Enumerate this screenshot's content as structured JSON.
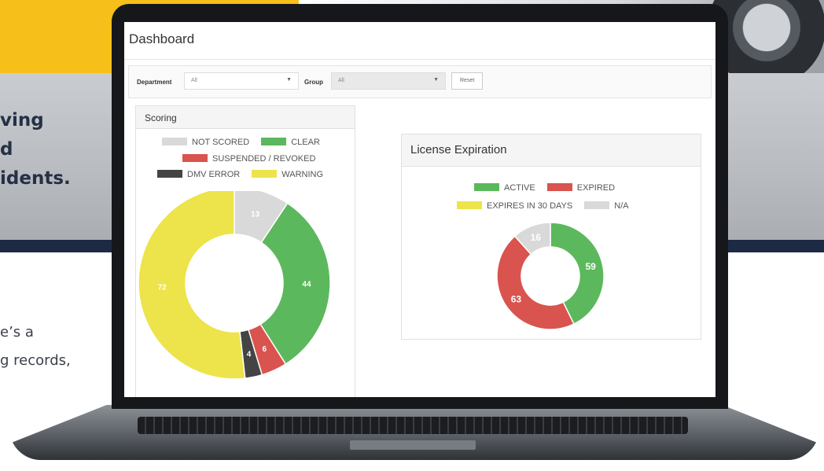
{
  "background": {
    "headline_lines": [
      "ving",
      "d",
      "idents."
    ],
    "body_lines": [
      "e’s a",
      "g records,"
    ]
  },
  "dashboard": {
    "title": "Dashboard",
    "filters": {
      "department_label": "Department",
      "department_value": "All",
      "group_label": "Group",
      "group_value": "All",
      "reset_label": "Reset"
    }
  },
  "scoring": {
    "title": "Scoring",
    "legend": {
      "not_scored": "NOT SCORED",
      "clear": "CLEAR",
      "suspended": "SUSPENDED / REVOKED",
      "dmv_error": "DMV ERROR",
      "warning": "WARNING"
    }
  },
  "license": {
    "title": "License Expiration",
    "legend": {
      "active": "ACTIVE",
      "expired": "EXPIRED",
      "expires_30": "EXPIRES IN 30 DAYS",
      "na": "N/A"
    }
  },
  "colors": {
    "green": "#5cb85c",
    "red": "#d9534f",
    "yellow": "#ede34a",
    "gray": "#d9d9d9",
    "dark": "#444444"
  },
  "chart_data": [
    {
      "type": "pie",
      "title": "Scoring",
      "categories": [
        "NOT SCORED",
        "CLEAR",
        "SUSPENDED / REVOKED",
        "DMV ERROR",
        "WARNING"
      ],
      "values": [
        13,
        44,
        6,
        4,
        72
      ],
      "colors": [
        "#d9d9d9",
        "#5cb85c",
        "#d9534f",
        "#444444",
        "#ede34a"
      ],
      "donut": true
    },
    {
      "type": "pie",
      "title": "License Expiration",
      "categories": [
        "ACTIVE",
        "EXPIRED",
        "EXPIRES IN 30 DAYS",
        "N/A"
      ],
      "values": [
        59,
        63,
        0,
        16
      ],
      "colors": [
        "#5cb85c",
        "#d9534f",
        "#ede34a",
        "#d9d9d9"
      ],
      "donut": true
    }
  ]
}
